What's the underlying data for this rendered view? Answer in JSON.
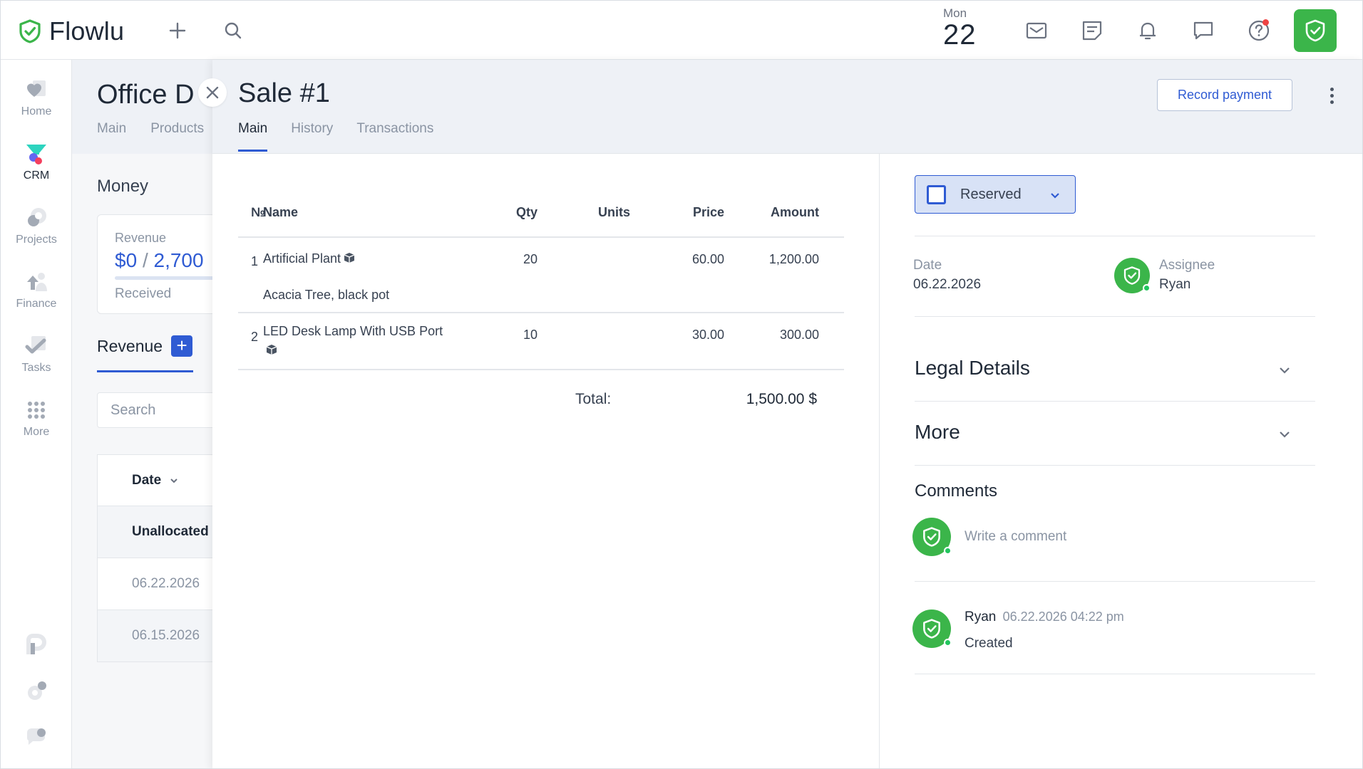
{
  "app": {
    "name": "Flowlu"
  },
  "topbar": {
    "date_dow": "Mon",
    "date_day": "22",
    "icons": [
      "mail-icon",
      "notes-icon",
      "bell-icon",
      "chat-icon",
      "help-icon"
    ],
    "accent": "#3bb54a"
  },
  "leftnav": {
    "items": [
      {
        "label": "Home",
        "icon": "heart-icon"
      },
      {
        "label": "CRM",
        "icon": "funnel-icon"
      },
      {
        "label": "Projects",
        "icon": "projects-icon"
      },
      {
        "label": "Finance",
        "icon": "finance-icon"
      },
      {
        "label": "Tasks",
        "icon": "check-icon"
      },
      {
        "label": "More",
        "icon": "grid-icon"
      }
    ]
  },
  "background_page": {
    "title": "Office D",
    "tabs": [
      "Main",
      "Products"
    ],
    "section": "Money",
    "revenue_card": {
      "label": "Revenue",
      "received": "$0",
      "separator": "/",
      "total": "2,700",
      "sub": "Received"
    },
    "revenue_tab": "Revenue",
    "search_placeholder": "Search",
    "table": {
      "header": "Date",
      "unallocated": "Unallocated",
      "dates": [
        "06.22.2026",
        "06.15.2026"
      ]
    }
  },
  "sale": {
    "title": "Sale #1",
    "tabs": [
      "Main",
      "History",
      "Transactions"
    ],
    "active_tab": "Main",
    "record_payment": "Record payment",
    "table": {
      "headers": {
        "num": "№",
        "name": "Name",
        "qty": "Qty",
        "units": "Units",
        "price": "Price",
        "amount": "Amount"
      },
      "rows": [
        {
          "num": "1",
          "name": "Artificial Plant",
          "description": "Acacia Tree, black pot",
          "qty": "20",
          "units": "",
          "price": "60.00",
          "amount": "1,200.00"
        },
        {
          "num": "2",
          "name": "LED Desk Lamp With USB Port",
          "description": "",
          "qty": "10",
          "units": "",
          "price": "30.00",
          "amount": "300.00"
        }
      ],
      "total_label": "Total:",
      "total_value": "1,500.00 $"
    },
    "status": {
      "label": "Reserved",
      "color": "#2f5bd3"
    },
    "date_label": "Date",
    "date_value": "06.22.2026",
    "assignee_label": "Assignee",
    "assignee_value": "Ryan",
    "legal_details": "Legal Details",
    "more": "More",
    "comments_title": "Comments",
    "comment_placeholder": "Write a comment",
    "activity": {
      "user": "Ryan",
      "time": "06.22.2026 04:22 pm",
      "text": "Created"
    }
  }
}
